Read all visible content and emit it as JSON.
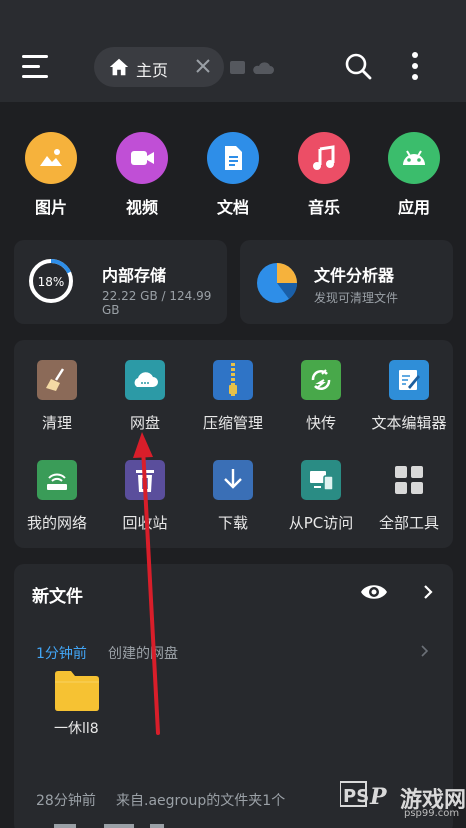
{
  "header": {
    "tab_label": "主页"
  },
  "categories": [
    {
      "label": "图片",
      "icon": "image-icon",
      "color": "#f6b23c"
    },
    {
      "label": "视频",
      "icon": "video-icon",
      "color": "#c04fd6"
    },
    {
      "label": "文档",
      "icon": "document-icon",
      "color": "#2e8ee8"
    },
    {
      "label": "音乐",
      "icon": "music-icon",
      "color": "#ec4e66"
    },
    {
      "label": "应用",
      "icon": "android-icon",
      "color": "#3bbd6c"
    }
  ],
  "storage": {
    "title": "内部存储",
    "percent_label": "18%",
    "percent": 18,
    "usage": "22.22 GB / 124.99 GB"
  },
  "analyzer": {
    "title": "文件分析器",
    "subtitle": "发现可清理文件"
  },
  "tools": [
    {
      "label": "清理",
      "icon": "broom-icon",
      "color": "#8b6a58"
    },
    {
      "label": "网盘",
      "icon": "cloud-drive-icon",
      "color": "#2c9aa6"
    },
    {
      "label": "压缩管理",
      "icon": "zip-icon",
      "color": "#2f74c6"
    },
    {
      "label": "快传",
      "icon": "transfer-icon",
      "color": "#48a84a"
    },
    {
      "label": "文本编辑器",
      "icon": "text-editor-icon",
      "color": "#2f8ed8"
    },
    {
      "label": "我的网络",
      "icon": "network-icon",
      "color": "#3a9c58"
    },
    {
      "label": "回收站",
      "icon": "recycle-bin-icon",
      "color": "#5a4e9c"
    },
    {
      "label": "下载",
      "icon": "download-icon",
      "color": "#3a6fb6"
    },
    {
      "label": "从PC访问",
      "icon": "pc-access-icon",
      "color": "#2a8c84"
    },
    {
      "label": "全部工具",
      "icon": "all-tools-icon",
      "color": "#d8d8d8"
    }
  ],
  "new_files": {
    "title": "新文件",
    "entry1_time": "1分钟前",
    "entry1_desc": "创建的网盘",
    "entry1_folder": "一休ll8",
    "entry2_time": "28分钟前",
    "entry2_desc": "来自.aegroup的文件夹1个"
  },
  "watermark": {
    "brand": "游戏网",
    "logo": "PS P",
    "url": "psp99.com"
  }
}
